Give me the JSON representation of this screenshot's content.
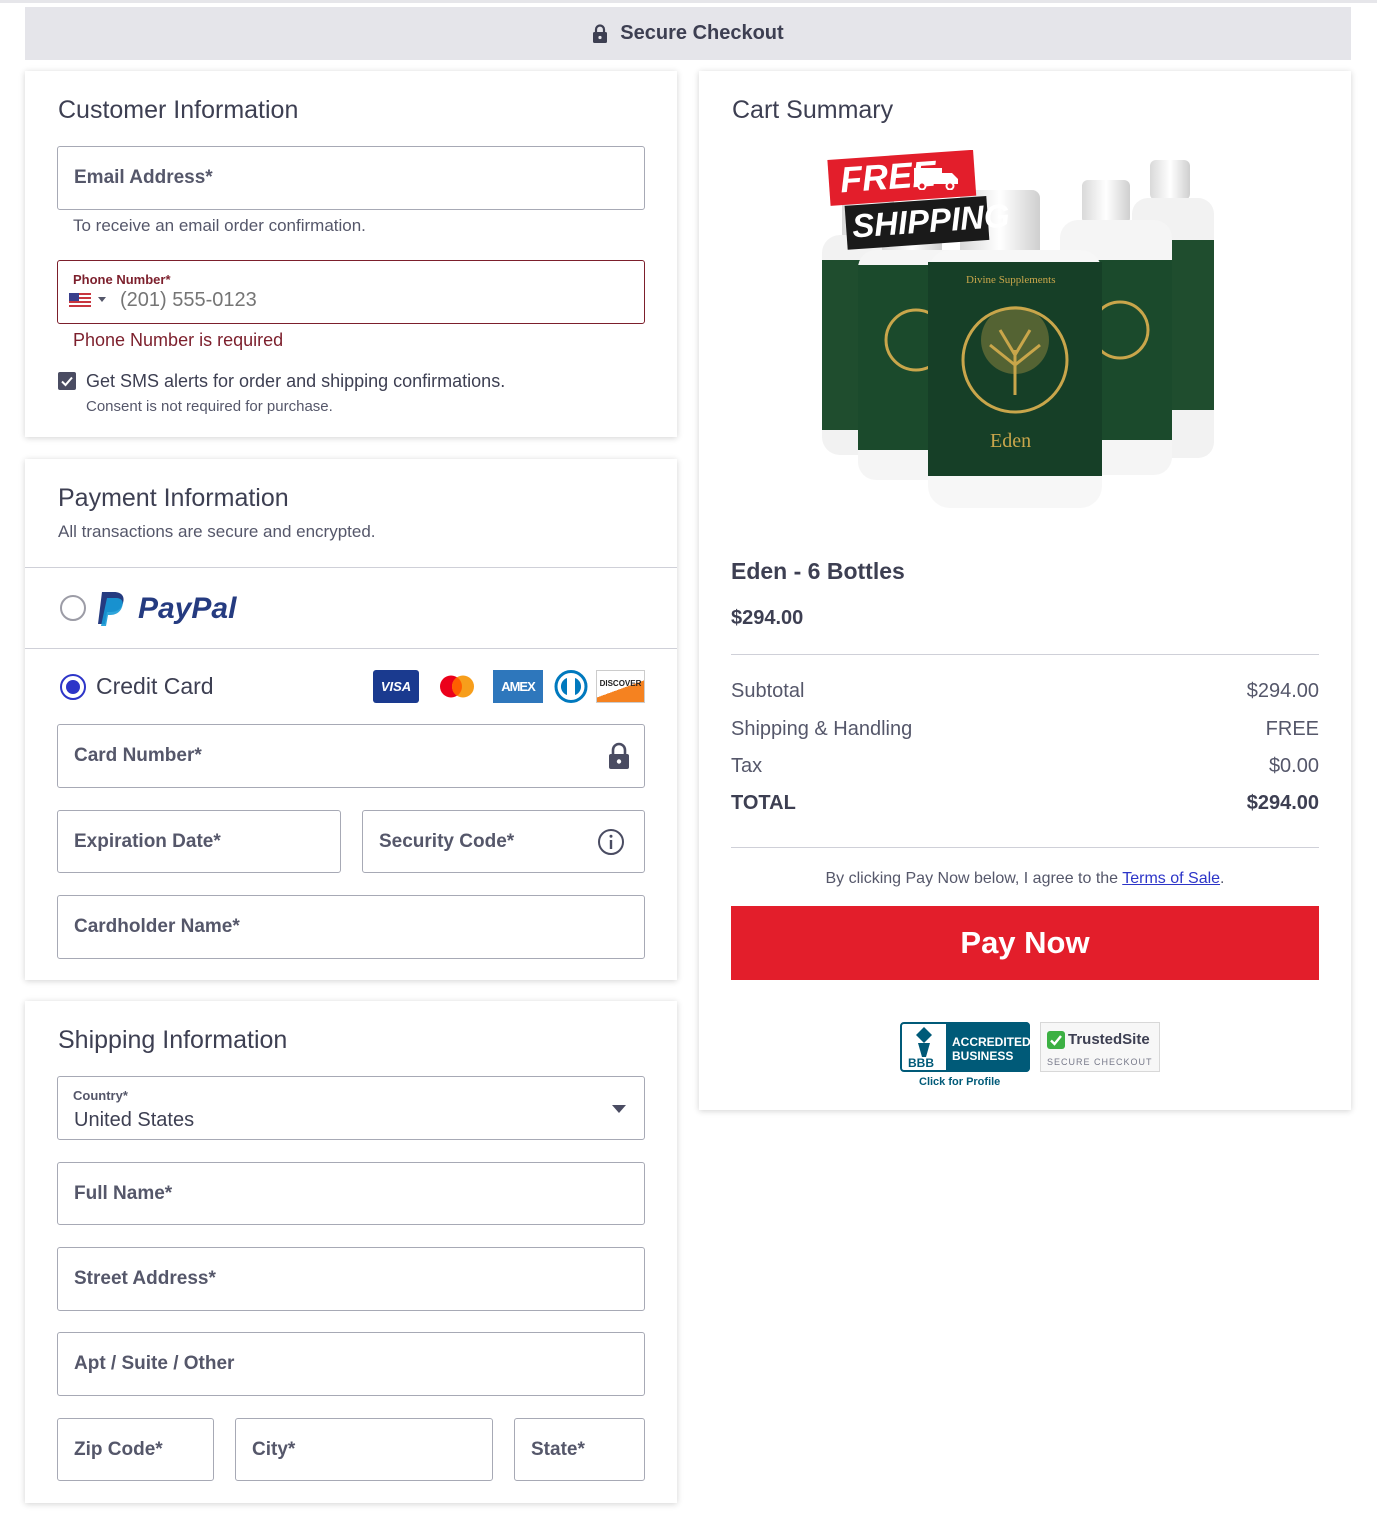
{
  "header": {
    "title": "Secure Checkout"
  },
  "customer": {
    "title": "Customer Information",
    "email_label": "Email Address*",
    "email_helper": "To receive an email order confirmation.",
    "phone_label": "Phone Number*",
    "phone_placeholder": "(201) 555-0123",
    "phone_error": "Phone Number is required",
    "sms_label": "Get SMS alerts for order and shipping confirmations.",
    "sms_checked": true,
    "sms_note": "Consent is not required for purchase."
  },
  "payment": {
    "title": "Payment Information",
    "subtitle": "All transactions are secure and encrypted.",
    "paypal_brand": "PayPal",
    "credit_label": "Credit Card",
    "card_brands": [
      "VISA",
      "mastercard",
      "AMEX",
      "diners",
      "DISCOVER"
    ],
    "card_number_label": "Card Number*",
    "expiration_label": "Expiration Date*",
    "security_label": "Security Code*",
    "cardholder_label": "Cardholder Name*"
  },
  "shipping": {
    "title": "Shipping Information",
    "country_label": "Country*",
    "country_value": "United States",
    "full_name_label": "Full Name*",
    "street_label": "Street Address*",
    "apt_label": "Apt / Suite / Other",
    "zip_label": "Zip Code*",
    "city_label": "City*",
    "state_label": "State*"
  },
  "cart": {
    "title": "Cart Summary",
    "banner_line1": "FREE",
    "banner_line2": "SHIPPING",
    "bottle_brand": "Divine Supplements",
    "bottle_name": "Eden",
    "product_name": "Eden - 6 Bottles",
    "product_price": "$294.00",
    "rows": [
      {
        "label": "Subtotal",
        "value": "$294.00"
      },
      {
        "label": "Shipping & Handling",
        "value": "FREE"
      },
      {
        "label": "Tax",
        "value": "$0.00"
      }
    ],
    "total_label": "TOTAL",
    "total_value": "$294.00",
    "terms_prefix": "By clicking Pay Now below, I agree to the ",
    "terms_link": "Terms of Sale",
    "terms_suffix": ".",
    "pay_button": "Pay Now",
    "bbb_line1": "ACCREDITED",
    "bbb_line2": "BUSINESS",
    "bbb_caption": "Click for Profile",
    "bbb_mark": "BBB",
    "trusted_name": "TrustedSite",
    "trusted_sub": "SECURE CHECKOUT"
  },
  "colors": {
    "accent": "#2d35c8",
    "error": "#7c1f2c",
    "pay_button": "#e31e2b",
    "header_bg": "#e5e5ea"
  }
}
